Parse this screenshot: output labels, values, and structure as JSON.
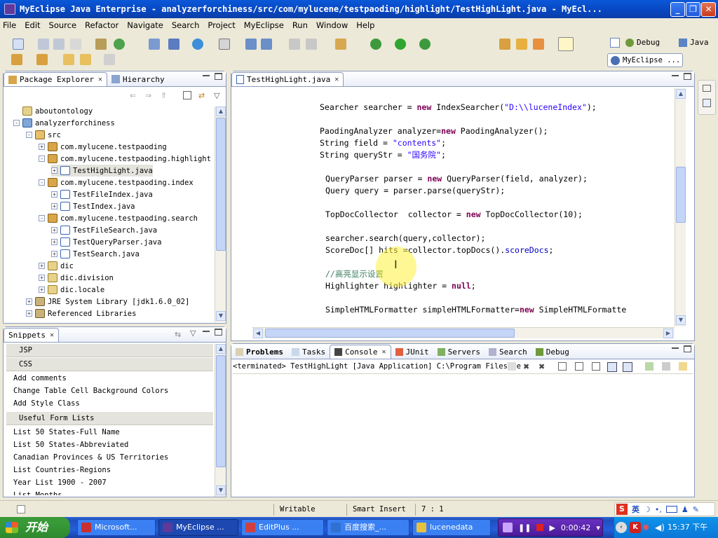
{
  "window": {
    "title": "MyEclipse Java Enterprise - analyzerforchiness/src/com/mylucene/testpaoding/highlight/TestHighLight.java - MyEcl..."
  },
  "menu": [
    "File",
    "Edit",
    "Source",
    "Refactor",
    "Navigate",
    "Search",
    "Project",
    "MyEclipse",
    "Run",
    "Window",
    "Help"
  ],
  "perspectives": {
    "debug": "Debug",
    "java": "Java",
    "myeclipse": "MyEclipse ..."
  },
  "package_explorer": {
    "tab_label": "Package Explorer",
    "hierarchy_label": "Hierarchy",
    "tree": [
      {
        "label": "aboutontology",
        "indent": 0,
        "icon": "folder",
        "exp": ""
      },
      {
        "label": "analyzerforchiness",
        "indent": 0,
        "icon": "project",
        "exp": "-"
      },
      {
        "label": "src",
        "indent": 1,
        "icon": "src",
        "exp": "-"
      },
      {
        "label": "com.mylucene.testpaoding",
        "indent": 2,
        "icon": "package",
        "exp": "+"
      },
      {
        "label": "com.mylucene.testpaoding.highlight",
        "indent": 2,
        "icon": "package",
        "exp": "-"
      },
      {
        "label": "TestHighLight.java",
        "indent": 3,
        "icon": "java",
        "exp": "+"
      },
      {
        "label": "com.mylucene.testpaoding.index",
        "indent": 2,
        "icon": "package",
        "exp": "-"
      },
      {
        "label": "TestFileIndex.java",
        "indent": 3,
        "icon": "java",
        "exp": "+"
      },
      {
        "label": "TestIndex.java",
        "indent": 3,
        "icon": "java",
        "exp": "+"
      },
      {
        "label": "com.mylucene.testpaoding.search",
        "indent": 2,
        "icon": "package",
        "exp": "-"
      },
      {
        "label": "TestFileSearch.java",
        "indent": 3,
        "icon": "java",
        "exp": "+"
      },
      {
        "label": "TestQueryParser.java",
        "indent": 3,
        "icon": "java",
        "exp": "+"
      },
      {
        "label": "TestSearch.java",
        "indent": 3,
        "icon": "java",
        "exp": "+"
      },
      {
        "label": "dic",
        "indent": 2,
        "icon": "folder",
        "exp": "+"
      },
      {
        "label": "dic.division",
        "indent": 2,
        "icon": "folder",
        "exp": "+"
      },
      {
        "label": "dic.locale",
        "indent": 2,
        "icon": "folder",
        "exp": "+"
      },
      {
        "label": "JRE System Library [jdk1.6.0_02]",
        "indent": 1,
        "icon": "library",
        "exp": "+"
      },
      {
        "label": "Referenced Libraries",
        "indent": 1,
        "icon": "library",
        "exp": "+"
      }
    ]
  },
  "editor": {
    "tab_label": "TestHighLight.java",
    "lines": [
      {
        "indent": 0,
        "parts": [
          [
            "t",
            "Searcher searcher = "
          ],
          [
            "k",
            "new"
          ],
          [
            "t",
            " IndexSearcher("
          ],
          [
            "s",
            "\"D:\\\\luceneIndex\""
          ],
          [
            "t",
            ");"
          ]
        ]
      },
      {
        "indent": 0,
        "parts": []
      },
      {
        "indent": 0,
        "parts": [
          [
            "t",
            "PaodingAnalyzer analyzer="
          ],
          [
            "k",
            "new"
          ],
          [
            "t",
            " PaodingAnalyzer();"
          ]
        ]
      },
      {
        "indent": 0,
        "parts": [
          [
            "t",
            "String field = "
          ],
          [
            "s",
            "\"contents\""
          ],
          [
            "t",
            ";"
          ]
        ]
      },
      {
        "indent": 0,
        "parts": [
          [
            "t",
            "String queryStr = "
          ],
          [
            "s",
            "\"国务院\""
          ],
          [
            "t",
            ";"
          ]
        ]
      },
      {
        "indent": 0,
        "parts": []
      },
      {
        "indent": 1,
        "parts": [
          [
            "t",
            "QueryParser parser = "
          ],
          [
            "k",
            "new"
          ],
          [
            "t",
            " QueryParser(field, analyzer);"
          ]
        ]
      },
      {
        "indent": 1,
        "parts": [
          [
            "t",
            "Query query = parser.parse(queryStr);"
          ]
        ]
      },
      {
        "indent": 0,
        "parts": []
      },
      {
        "indent": 1,
        "parts": [
          [
            "t",
            "TopDocCollector  collector = "
          ],
          [
            "k",
            "new"
          ],
          [
            "t",
            " TopDocCollector(10);"
          ]
        ]
      },
      {
        "indent": 0,
        "parts": []
      },
      {
        "indent": 1,
        "parts": [
          [
            "t",
            "searcher.search(query,collector);"
          ]
        ]
      },
      {
        "indent": 1,
        "parts": [
          [
            "t",
            "ScoreDoc[] hits =collector.topDocs()."
          ],
          [
            "f",
            "scoreDocs"
          ],
          [
            "t",
            ";"
          ]
        ]
      },
      {
        "indent": 0,
        "parts": []
      },
      {
        "indent": 1,
        "parts": [
          [
            "c",
            "//高亮显示设置"
          ]
        ]
      },
      {
        "indent": 1,
        "parts": [
          [
            "t",
            "Highlighter highlighter = "
          ],
          [
            "k",
            "null"
          ],
          [
            "t",
            ";"
          ]
        ]
      },
      {
        "indent": 0,
        "parts": []
      },
      {
        "indent": 1,
        "parts": [
          [
            "t",
            "SimpleHTMLFormatter simpleHTMLFormatter="
          ],
          [
            "k",
            "new"
          ],
          [
            "t",
            " SimpleHTMLFormatte"
          ]
        ]
      }
    ]
  },
  "snippets": {
    "tab_label": "Snippets",
    "categories": [
      {
        "label": "JSP",
        "items": []
      },
      {
        "label": "CSS",
        "items": [
          "Add comments",
          "Change Table Cell Background Colors",
          "Add Style Class"
        ]
      },
      {
        "label": "Useful Form Lists",
        "items": [
          "List 50 States-Full Name",
          "List 50 States-Abbreviated",
          "Canadian Provinces & US Territories",
          "List Countries-Regions",
          "Year List 1900 - 2007",
          "List Months"
        ]
      }
    ]
  },
  "bottom_tabs": [
    "Problems",
    "Tasks",
    "Console",
    "JUnit",
    "Servers",
    "Search",
    "Debug"
  ],
  "console": {
    "header": "<terminated> TestHighLight [Java Application] C:\\Program Files\\Je"
  },
  "status": {
    "writable": "Writable",
    "insert_mode": "Smart Insert",
    "position": "7 : 1"
  },
  "taskbar": {
    "start": "开始",
    "tasks": [
      "Microsoft...",
      "MyEclipse ...",
      "EditPlus ...",
      "百度搜索_...",
      "lucenedata"
    ],
    "recorder_time": "0:00:42",
    "ime": "英",
    "clock": "15:37 下午"
  }
}
